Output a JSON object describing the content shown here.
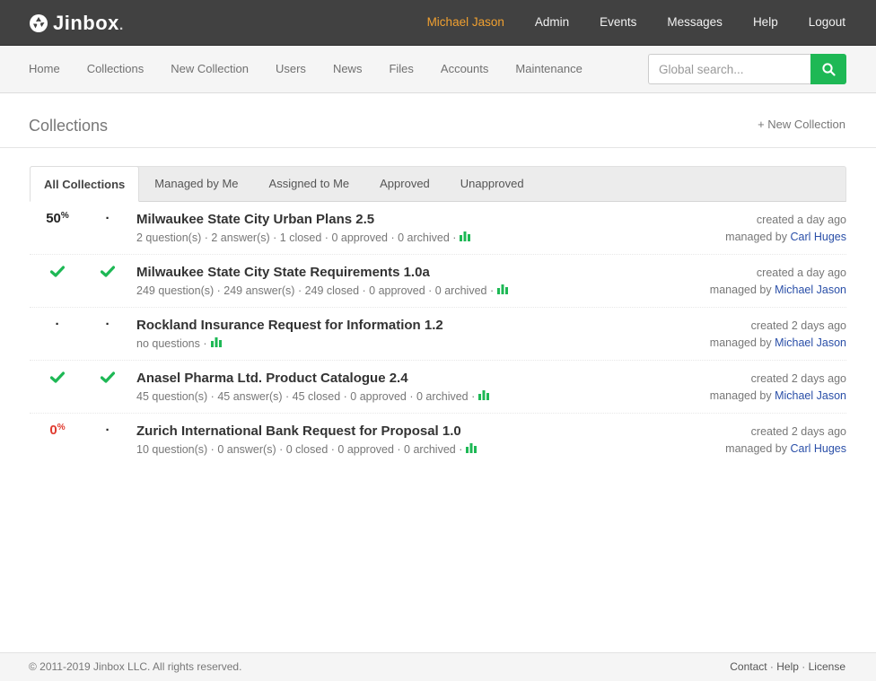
{
  "app": {
    "logo_text": "Jinbox",
    "logo_dot": "."
  },
  "topnav": {
    "user": "Michael Jason",
    "items": [
      "Admin",
      "Events",
      "Messages",
      "Help",
      "Logout"
    ]
  },
  "subnav": {
    "items": [
      "Home",
      "Collections",
      "New Collection",
      "Users",
      "News",
      "Files",
      "Accounts",
      "Maintenance"
    ],
    "search_placeholder": "Global search..."
  },
  "page": {
    "title": "Collections",
    "new_collection": "+ New Collection"
  },
  "tabs": [
    "All Collections",
    "Managed by Me",
    "Assigned to Me",
    "Approved",
    "Unapproved"
  ],
  "collections": [
    {
      "status1": "50",
      "status1_unit": "%",
      "status1_kind": "percent",
      "status2": "·",
      "status2_kind": "dot",
      "title": "Milwaukee State City Urban Plans 2.5",
      "meta": "2 question(s) · 2 answer(s) · 1 closed · 0 approved · 0 archived ·",
      "created": "created a day ago",
      "managed_prefix": "managed by",
      "manager": "Carl Huges"
    },
    {
      "status1": "",
      "status1_kind": "check",
      "status2": "",
      "status2_kind": "check",
      "title": "Milwaukee State City State Requirements 1.0a",
      "meta": "249 question(s) · 249 answer(s) · 249 closed · 0 approved · 0 archived ·",
      "created": "created a day ago",
      "managed_prefix": "managed by",
      "manager": "Michael Jason"
    },
    {
      "status1": "·",
      "status1_kind": "dot",
      "status2": "·",
      "status2_kind": "dot",
      "title": "Rockland Insurance Request for Information 1.2",
      "meta": "no questions ·",
      "created": "created 2 days ago",
      "managed_prefix": "managed by",
      "manager": "Michael Jason"
    },
    {
      "status1": "",
      "status1_kind": "check",
      "status2": "",
      "status2_kind": "check",
      "title": "Anasel Pharma Ltd. Product Catalogue 2.4",
      "meta": "45 question(s) · 45 answer(s) · 45 closed · 0 approved · 0 archived ·",
      "created": "created 2 days ago",
      "managed_prefix": "managed by",
      "manager": "Michael Jason"
    },
    {
      "status1": "0",
      "status1_unit": "%",
      "status1_kind": "percent-red",
      "status2": "·",
      "status2_kind": "dot",
      "title": "Zurich International Bank Request for Proposal 1.0",
      "meta": "10 question(s) · 0 answer(s) · 0 closed · 0 approved · 0 archived ·",
      "created": "created 2 days ago",
      "managed_prefix": "managed by",
      "manager": "Carl Huges"
    }
  ],
  "footer": {
    "copyright": "© 2011-2019 Jinbox LLC. All rights reserved.",
    "links": [
      "Contact",
      "Help",
      "License"
    ],
    "separator": " · "
  },
  "colors": {
    "accent_green": "#1eb855",
    "user_orange": "#f0a030",
    "link_blue": "#2a4fa8",
    "percent_red": "#e03a2e"
  }
}
